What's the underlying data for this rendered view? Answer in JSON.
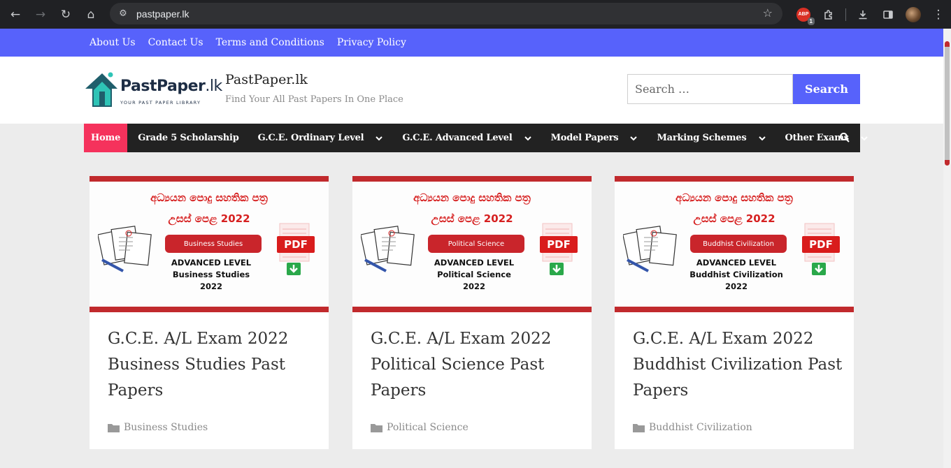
{
  "browser": {
    "url": "pastpaper.lk",
    "extension_badge": "ABP",
    "extension_count": "1"
  },
  "topbar": {
    "links": [
      "About Us",
      "Contact Us",
      "Terms and Conditions",
      "Privacy Policy"
    ]
  },
  "header": {
    "logo_name": "PastPaper",
    "logo_suffix": ".lk",
    "logo_tagline": "YOUR PAST PAPER LIBRARY",
    "site_title": "PastPaper.lk",
    "site_description": "Find Your All Past Papers In One Place",
    "search_placeholder": "Search …",
    "search_button": "Search"
  },
  "nav": {
    "items": [
      {
        "label": "Home"
      },
      {
        "label": "Grade 5 Scholarship"
      },
      {
        "label": "G.C.E. Ordinary Level"
      },
      {
        "label": "G.C.E. Advanced Level"
      },
      {
        "label": "Model Papers"
      },
      {
        "label": "Marking Schemes"
      },
      {
        "label": "Other Exams"
      }
    ]
  },
  "posts": [
    {
      "thumb_line1": "අධ්‍යයන පොදු සහතික පත්‍ර",
      "thumb_line2": "උසස් පෙළ 2022",
      "thumb_subject": "Business Studies",
      "thumb_level": "ADVANCED LEVEL",
      "thumb_subject_bold": "Business Studies",
      "thumb_year": "2022",
      "pdf_label": "PDF",
      "title": "G.C.E. A/L Exam 2022 Business Studies Past Papers",
      "category": "Business Studies"
    },
    {
      "thumb_line1": "අධ්‍යයන පොදු සහතික පත්‍ර",
      "thumb_line2": "උසස් පෙළ 2022",
      "thumb_subject": "Political Science",
      "thumb_level": "ADVANCED LEVEL",
      "thumb_subject_bold": "Political Science",
      "thumb_year": "2022",
      "pdf_label": "PDF",
      "title": "G.C.E. A/L Exam 2022 Political Science Past Papers",
      "category": "Political Science"
    },
    {
      "thumb_line1": "අධ්‍යයන පොදු සහතික පත්‍ර",
      "thumb_line2": "උසස් පෙළ 2022",
      "thumb_subject": "Buddhist Civilization",
      "thumb_level": "ADVANCED LEVEL",
      "thumb_subject_bold": "Buddhist Civilization",
      "thumb_year": "2022",
      "pdf_label": "PDF",
      "title": "G.C.E. A/L Exam 2022 Buddhist Civilization Past Papers",
      "category": "Buddhist Civilization"
    }
  ],
  "colors": {
    "accent": "#5762fb",
    "nav_active": "#f5325c",
    "nav_bg": "#222222",
    "thumb_red": "#c12a2d"
  }
}
